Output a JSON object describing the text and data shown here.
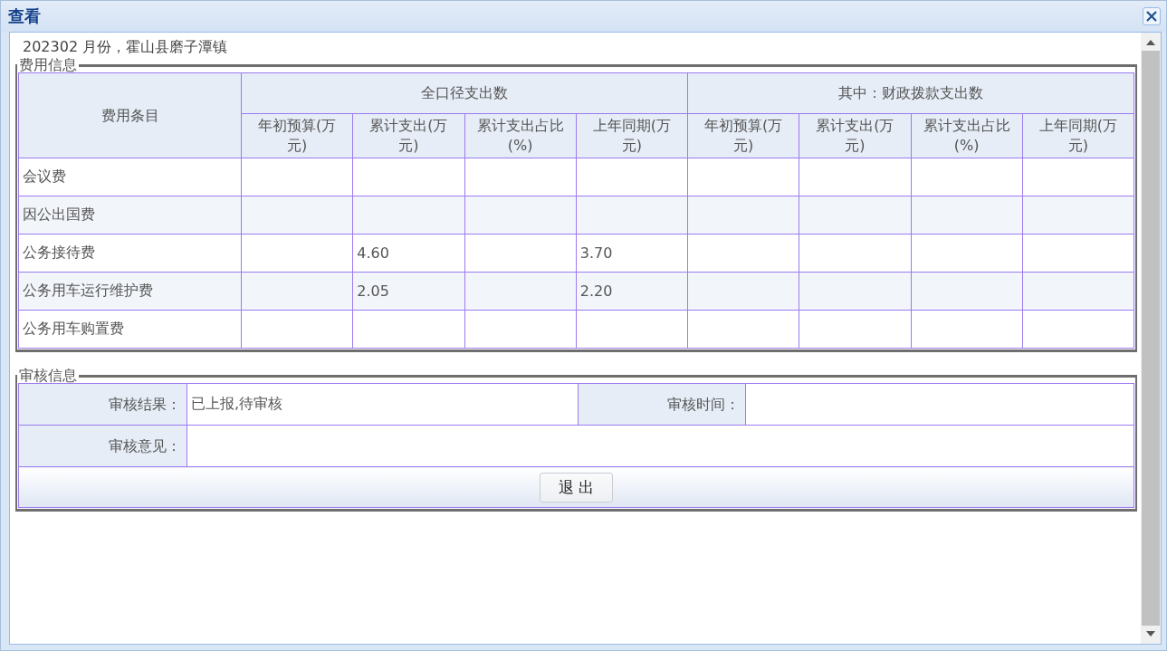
{
  "window": {
    "title": "查看"
  },
  "subtitle": "202302 月份，霍山县磨子潭镇",
  "fee_section": {
    "legend": "费用信息",
    "item_header": "费用条目",
    "groups": [
      {
        "label": "全口径支出数",
        "columns": [
          "年初预算(万元)",
          "累计支出(万元)",
          "累计支出占比(%)",
          "上年同期(万元)"
        ]
      },
      {
        "label": "其中：财政拨款支出数",
        "columns": [
          "年初预算(万元)",
          "累计支出(万元)",
          "累计支出占比(%)",
          "上年同期(万元)"
        ]
      }
    ],
    "rows": [
      {
        "item": "会议费"
      },
      {
        "item": "因公出国费"
      },
      {
        "item": "公务接待费",
        "all_scope": {
          "cumulative_spending": "4.60",
          "prior_year_same_period": "3.70"
        }
      },
      {
        "item": "公务用车运行维护费",
        "all_scope": {
          "cumulative_spending": "2.05",
          "prior_year_same_period": "2.20"
        }
      },
      {
        "item": "公务用车购置费"
      }
    ]
  },
  "review_section": {
    "legend": "审核信息",
    "result_label": "审核结果：",
    "result_value": "已上报,待审核",
    "time_label": "审核时间：",
    "opinion_label": "审核意见：",
    "exit_button": "退 出"
  }
}
